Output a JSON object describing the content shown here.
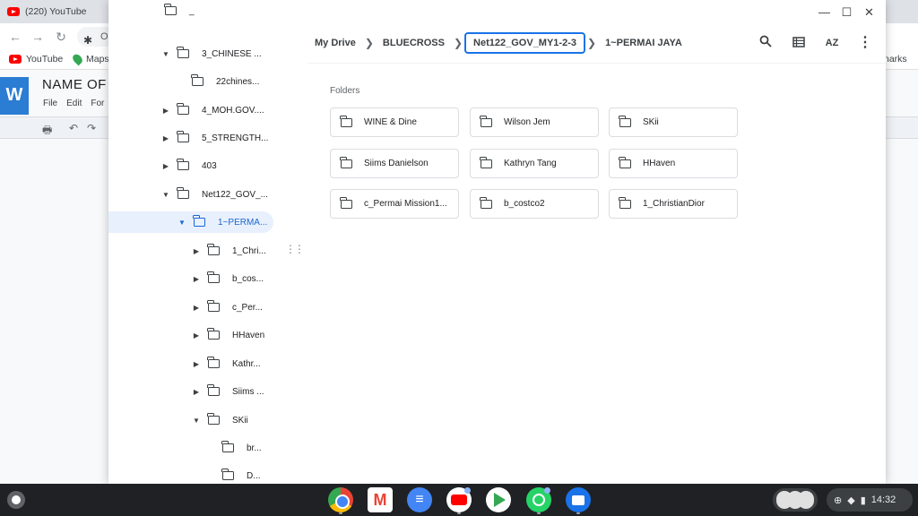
{
  "background_browser": {
    "tab_title": "(220) YouTube",
    "omnibox_partial": "O",
    "bookmarks": [
      "YouTube",
      "Maps"
    ],
    "bookmarks_right_partial": "narks",
    "doc_title_partial": "NAME OF C",
    "doc_menu": [
      "File",
      "Edit",
      "For"
    ],
    "word_letter": "W"
  },
  "window_controls": {
    "minimize": "—",
    "maximize": "☐",
    "close": "✕"
  },
  "tree": {
    "items": [
      {
        "label": "3_CHINESE ...",
        "expanded": true
      },
      {
        "label": "22chines...",
        "expanded": null
      },
      {
        "label": "4_MOH.GOV....",
        "expanded": false
      },
      {
        "label": "5_STRENGTH...",
        "expanded": false
      },
      {
        "label": "403",
        "expanded": false
      },
      {
        "label": "Net122_GOV_...",
        "expanded": true
      },
      {
        "label": "1~PERMA...",
        "expanded": true,
        "selected": true
      },
      {
        "label": "1_Chri...",
        "expanded": false
      },
      {
        "label": "b_cos...",
        "expanded": false
      },
      {
        "label": "c_Per...",
        "expanded": false
      },
      {
        "label": "HHaven",
        "expanded": false
      },
      {
        "label": "Kathr...",
        "expanded": false
      },
      {
        "label": "Siims ...",
        "expanded": false
      },
      {
        "label": "SKii",
        "expanded": true
      },
      {
        "label": "br...",
        "expanded": null
      },
      {
        "label": "D...",
        "expanded": null
      }
    ]
  },
  "breadcrumb": [
    "My Drive",
    "BLUECROSS",
    "Net122_GOV_MY1-2-3",
    "1~PERMAI JAYA"
  ],
  "toolbar_icons": [
    "search-icon",
    "list-view-icon",
    "sort-az-icon",
    "more-vert-icon"
  ],
  "main": {
    "section_label": "Folders",
    "folders": [
      "WINE & Dine",
      "Wilson Jem",
      "SKii",
      "Siims Danielson",
      "Kathryn Tang",
      "HHaven",
      "c_Permai Mission1...",
      "b_costco2",
      "1_ChristianDior"
    ]
  },
  "shelf": {
    "apps": [
      "chrome-icon",
      "gmail-icon",
      "docs-icon",
      "youtube-icon",
      "play-store-icon",
      "whatsapp-icon",
      "files-icon"
    ],
    "time": "14:32"
  }
}
